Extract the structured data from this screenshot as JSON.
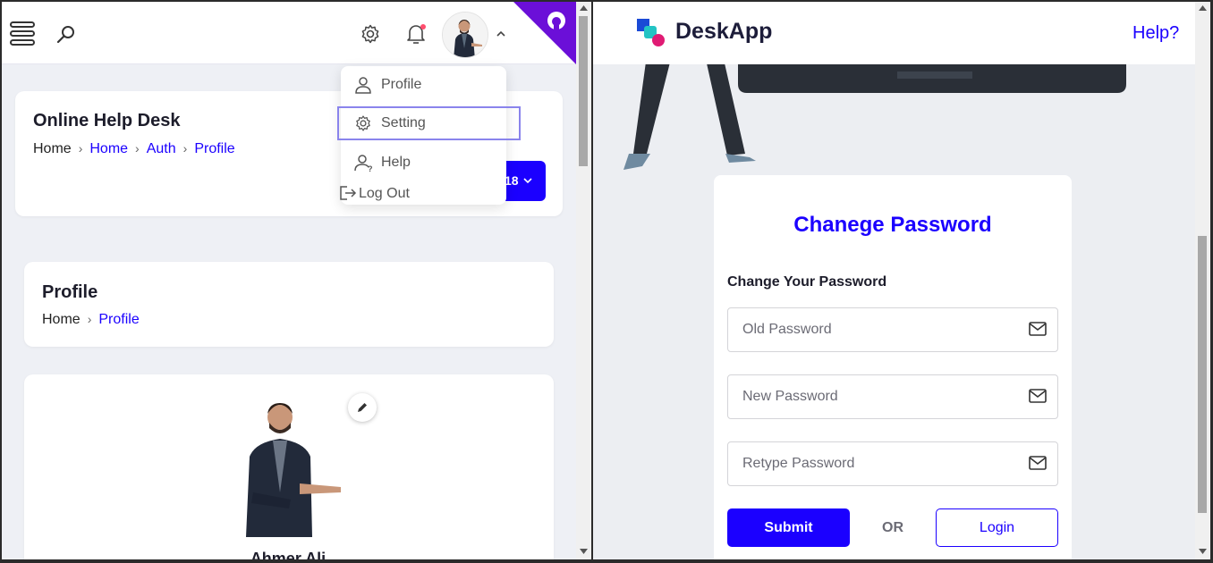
{
  "left": {
    "dropdown": {
      "items": [
        {
          "label": "Profile",
          "icon": "user-icon"
        },
        {
          "label": "Setting",
          "icon": "gear-icon"
        },
        {
          "label": "Help",
          "icon": "help-user-icon"
        },
        {
          "label": "Log Out",
          "icon": "logout-icon"
        }
      ]
    },
    "helpdesk_card": {
      "title": "Online Help Desk",
      "breadcrumb": [
        "Home",
        "Home",
        "Auth",
        "Profile"
      ]
    },
    "date_button": {
      "label": "18"
    },
    "profile_card": {
      "title": "Profile",
      "breadcrumb": [
        "Home",
        "Profile"
      ]
    },
    "person": {
      "name": "Ahmer Ali"
    }
  },
  "right": {
    "brand": "DeskApp",
    "help": "Help?",
    "form": {
      "title": "Chanege Password",
      "subtitle": "Change Your Password",
      "fields": [
        {
          "placeholder": "Old Password",
          "icon": "envelope-icon"
        },
        {
          "placeholder": "New Password",
          "icon": "envelope-icon"
        },
        {
          "placeholder": "Retype Password",
          "icon": "envelope-icon"
        }
      ],
      "submit": "Submit",
      "or": "OR",
      "login": "Login"
    }
  },
  "colors": {
    "accent": "#1b00ff",
    "ribbon": "#6b0fd8",
    "notification": "#ff4d6d"
  }
}
